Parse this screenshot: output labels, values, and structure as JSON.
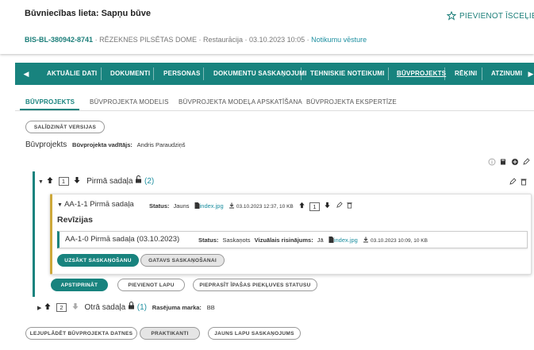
{
  "header": {
    "title": "Būvniecības lieta: Sapņu būve",
    "case_number": "BIS-BL-380942-8741",
    "authority": "RĒZEKNES PILSĒTAS DOME",
    "stage": "Restaurācija",
    "datetime": "03.10.2023 10:05",
    "history_link": "Notikumu vēsture",
    "separator": "·",
    "follow_label": "PIEVIENOT ĪSCEĻIEM"
  },
  "nav": {
    "items": [
      "AKTUĀLIE DATI",
      "DOKUMENTI",
      "PERSONAS",
      "DOKUMENTU SASKAŅOJUMI",
      "TEHNISKIE NOTEIKUMI",
      "BŪVPROJEKTS",
      "RĒĶINI",
      "ATZINUMI"
    ],
    "active": "BŪVPROJEKTS"
  },
  "subtabs": {
    "items": [
      "BŪVPROJEKTS",
      "BŪVPROJEKTA MODELIS",
      "BŪVPROJEKTA MODEĻA APSKATĪŠANA",
      "BŪVPROJEKTA EKSPERTĪZE"
    ],
    "active": "BŪVPROJEKTS"
  },
  "compare_button": "SALĪDZINĀT VERSIJAS",
  "project": {
    "label": "Būvprojekts",
    "manager_label": "Būvprojekta vadītājs:",
    "manager_name": "Andris Paraudziņš"
  },
  "section1": {
    "number": "1",
    "title": "Pirmā sadaļa",
    "count": "(2)",
    "part": {
      "title": "AA-1-1 Pirmā sadaļa",
      "status_label": "Status:",
      "status_value": "Jauns",
      "file_name": "index.jpg",
      "file_info": "03.10.2023 12:37, 10 KB",
      "number": "1",
      "revisions_title": "Revīzijas",
      "revision": {
        "title": "AA-1-0 Pirmā sadaļa (03.10.2023)",
        "status_label": "Status:",
        "status_value": "Saskaņots",
        "visual_label": "Vizuālais risinājums:",
        "visual_value": "Jā",
        "file_name": "index.jpg",
        "file_info": "03.10.2023 10:09, 10 KB"
      },
      "start_button": "UZSĀKT SASKAŅOŠANU",
      "ready_button": "GATAVS SASKAŅOŠANAI"
    },
    "approve_button": "APSTIPRINĀT",
    "add_page_button": "PIEVIENOT LAPU",
    "request_status_button": "PIEPRASĪT ĪPAŠAS PIEKĻUVES STATUSU"
  },
  "section2": {
    "number": "2",
    "title": "Otrā sadaļa",
    "count": "(1)",
    "mark_label": "Rasējuma marka:",
    "mark_value": "BB"
  },
  "bottom_buttons": {
    "download": "LEJUPLĀDĒT BŪVPROJEKTA DATNES",
    "trainees": "PRAKTIKANTI",
    "new_pages": "JAUNS LAPU SASKAŅOJUMS"
  },
  "colors": {
    "accent": "#18837e",
    "revision_accent": "#cda83a"
  }
}
